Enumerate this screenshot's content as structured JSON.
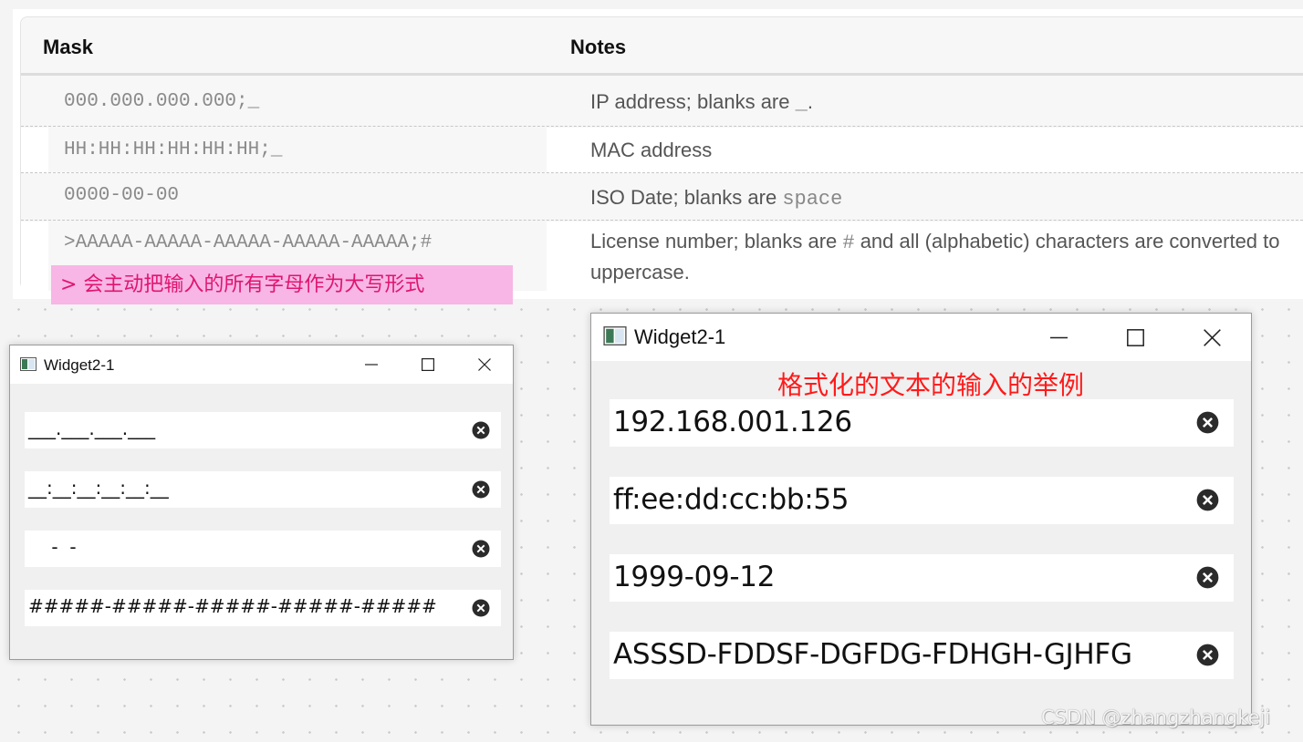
{
  "doc_table": {
    "headers": {
      "mask": "Mask",
      "notes": "Notes"
    },
    "rows": [
      {
        "mask": "000.000.000.000;_",
        "notes_pre": "IP address; blanks are ",
        "notes_code": "_",
        "notes_post": "."
      },
      {
        "mask": "HH:HH:HH:HH:HH:HH;_",
        "notes_pre": "MAC address",
        "notes_code": "",
        "notes_post": ""
      },
      {
        "mask": "0000-00-00",
        "notes_pre": "ISO Date; blanks are ",
        "notes_code": "space",
        "notes_post": ""
      },
      {
        "mask": ">AAAAA-AAAAA-AAAAA-AAAAA-AAAAA;#",
        "notes_pre": "License number; blanks are ",
        "notes_code": "#",
        "notes_post": " and all (alphabetic) characters are converted to uppercase."
      }
    ]
  },
  "annotation": "> 会主动把输入的所有字母作为大写形式",
  "window_small": {
    "title": "Widget2-1",
    "fields": [
      "___.___.___.___",
      "__:__:__:__:__:__",
      "    -  -",
      "#####-#####-#####-#####-#####"
    ]
  },
  "window_large": {
    "title": "Widget2-1",
    "caption": "格式化的文本的输入的举例",
    "fields": [
      "192.168.001.126",
      "ff:ee:dd:cc:bb:55",
      "1999-09-12",
      "ASSSD-FDDSF-DGFDG-FDHGH-GJHFG"
    ]
  },
  "watermark": "CSDN @zhangzhangkeji",
  "icons": {
    "app": "app-window-icon",
    "minimize": "minimize-icon",
    "maximize": "maximize-icon",
    "close": "close-icon",
    "clear": "clear-circle-x-icon"
  },
  "colors": {
    "annotation_bg": "#f7b6e6",
    "annotation_text": "#e0156f",
    "caption_red": "#ff1a1a"
  }
}
